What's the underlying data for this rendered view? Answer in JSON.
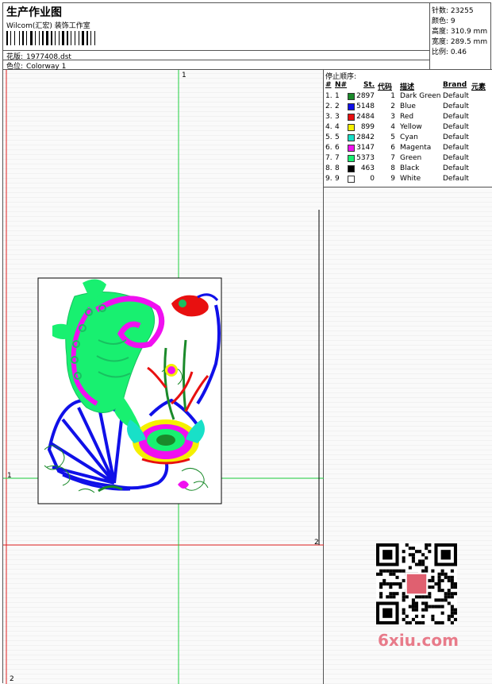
{
  "header": {
    "title": "生产作业图",
    "company": "Wilcom(汇宏) 装饰工作室",
    "design_label": "花版:",
    "design_file": "1977408.dst",
    "colorway_label": "色位:",
    "colorway": "Colorway 1"
  },
  "stats": [
    {
      "label": "针数:",
      "value": "23255"
    },
    {
      "label": "颜色:",
      "value": "9"
    },
    {
      "label": "高度:",
      "value": "310.9 mm"
    },
    {
      "label": "宽度:",
      "value": "289.5 mm"
    },
    {
      "label": "比例:",
      "value": "0.46"
    }
  ],
  "legend": {
    "title": "停止顺序:",
    "columns": {
      "num": "#",
      "no": "N#",
      "stitches": "St.",
      "code": "代码",
      "desc": "描述",
      "brand": "Brand",
      "element": "元素"
    },
    "rows": [
      {
        "num": "1.",
        "no": "1",
        "stitches": "2897",
        "code": "1",
        "desc": "Dark Green",
        "brand": "Default",
        "color": "#1a8a2a"
      },
      {
        "num": "2.",
        "no": "2",
        "stitches": "5148",
        "code": "2",
        "desc": "Blue",
        "brand": "Default",
        "color": "#1010e8"
      },
      {
        "num": "3.",
        "no": "3",
        "stitches": "2484",
        "code": "3",
        "desc": "Red",
        "brand": "Default",
        "color": "#e81010"
      },
      {
        "num": "4.",
        "no": "4",
        "stitches": "899",
        "code": "4",
        "desc": "Yellow",
        "brand": "Default",
        "color": "#f5f000"
      },
      {
        "num": "5.",
        "no": "5",
        "stitches": "2842",
        "code": "5",
        "desc": "Cyan",
        "brand": "Default",
        "color": "#18e0c8"
      },
      {
        "num": "6.",
        "no": "6",
        "stitches": "3147",
        "code": "6",
        "desc": "Magenta",
        "brand": "Default",
        "color": "#f010f0"
      },
      {
        "num": "7.",
        "no": "7",
        "stitches": "5373",
        "code": "7",
        "desc": "Green",
        "brand": "Default",
        "color": "#18f070"
      },
      {
        "num": "8.",
        "no": "8",
        "stitches": "463",
        "code": "8",
        "desc": "Black",
        "brand": "Default",
        "color": "#000000"
      },
      {
        "num": "9.",
        "no": "9",
        "stitches": "0",
        "code": "9",
        "desc": "White",
        "brand": "Default",
        "color": "#ffffff"
      }
    ]
  },
  "axis_labels": {
    "top": "1",
    "left": "1",
    "right": "2",
    "bottom": "2"
  },
  "watermark": "6xiu.com"
}
